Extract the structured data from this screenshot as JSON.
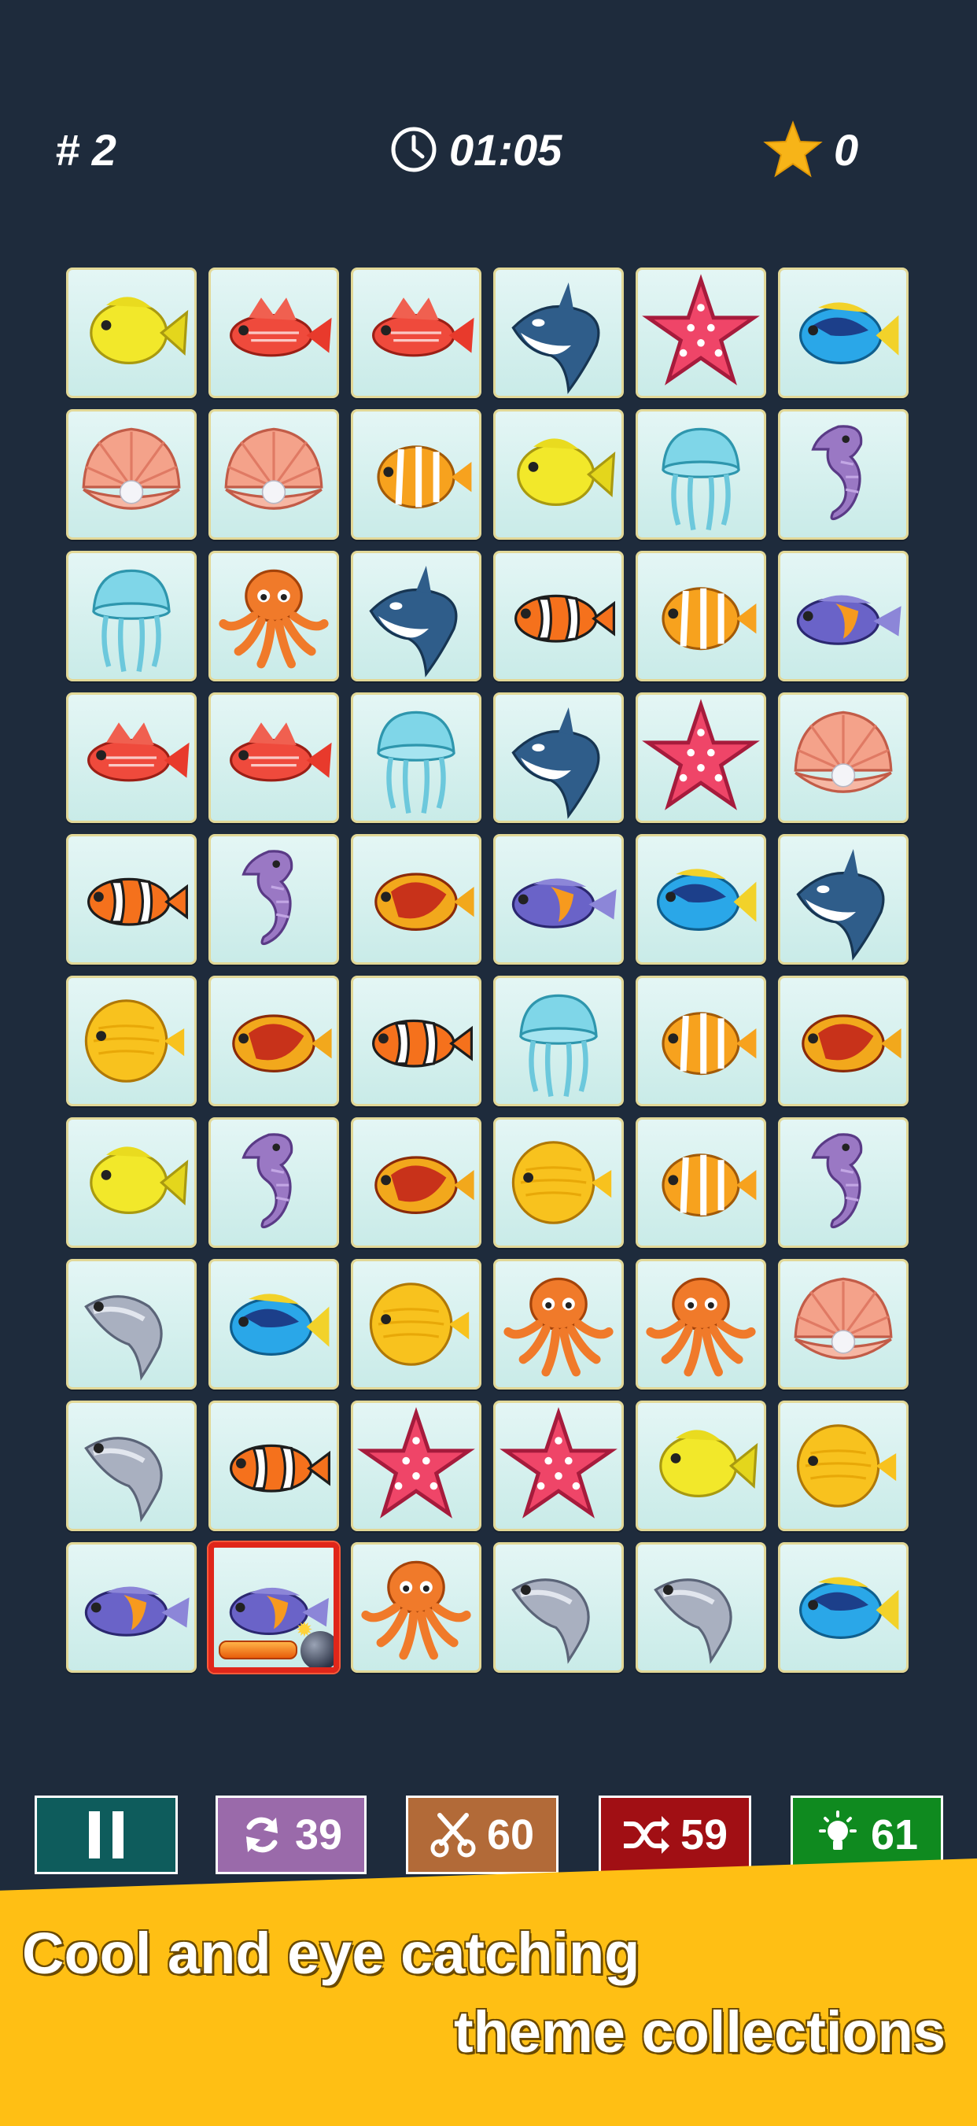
{
  "hud": {
    "level": "# 2",
    "timer": "01:05",
    "score": "0"
  },
  "board": {
    "columns": 6,
    "rows": [
      [
        "yellow-tang",
        "red-squirrelfish",
        "red-squirrelfish",
        "orca",
        "starfish",
        "blue-tang"
      ],
      [
        "clam-shell",
        "clam-shell",
        "butterflyfish",
        "yellow-tang",
        "jellyfish",
        "seahorse"
      ],
      [
        "jellyfish",
        "octopus",
        "orca",
        "clownfish",
        "butterflyfish",
        "angelfish"
      ],
      [
        "red-squirrelfish",
        "red-squirrelfish",
        "jellyfish",
        "orca",
        "starfish",
        "clam-shell"
      ],
      [
        "clownfish",
        "seahorse",
        "red-butterflyfish",
        "angelfish",
        "blue-tang",
        "orca"
      ],
      [
        "yellow-discus",
        "red-butterflyfish",
        "clownfish",
        "jellyfish",
        "butterflyfish",
        "red-butterflyfish"
      ],
      [
        "yellow-tang",
        "seahorse",
        "red-butterflyfish",
        "yellow-discus",
        "butterflyfish",
        "seahorse"
      ],
      [
        "sardine",
        "blue-tang",
        "yellow-discus",
        "octopus",
        "octopus",
        "clam-shell"
      ],
      [
        "sardine",
        "clownfish",
        "starfish",
        "starfish",
        "yellow-tang",
        "yellow-discus"
      ],
      [
        "angelfish",
        "angelfish",
        "octopus",
        "sardine",
        "sardine",
        "blue-tang"
      ]
    ],
    "selected": {
      "row": 9,
      "col": 1
    },
    "bomb_fuse": 0.6
  },
  "toolbar": {
    "rotate_count": "39",
    "scissors_count": "60",
    "shuffle_count": "59",
    "hint_count": "61"
  },
  "promo": {
    "line1": "Cool and eye catching",
    "line2": "theme collections"
  },
  "colors": {
    "background": "#1e2b3c",
    "tile": "#d6f0ee",
    "pause": "#0e5c5c",
    "rotate": "#9a6aaa",
    "scissors": "#b26a38",
    "shuffle": "#a10f14",
    "hint": "#0f8a1f",
    "banner": "#ffbf14"
  }
}
